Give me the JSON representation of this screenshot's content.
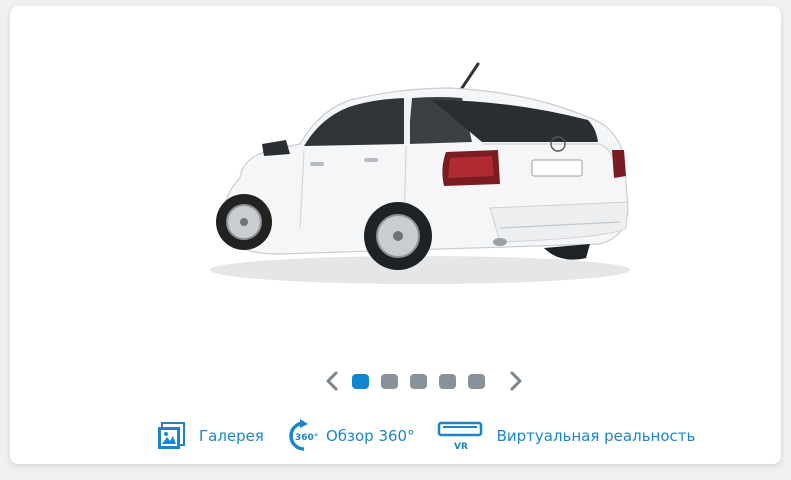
{
  "carousel": {
    "slide_count": 5,
    "active_index": 0,
    "image_alt": "car-photo"
  },
  "actions": {
    "gallery_label": "Галерея",
    "view360_label": "Обзор 360°",
    "view360_icon_text": "360°",
    "vr_label": "Виртуальная реальность",
    "vr_icon_text": "VR"
  },
  "colors": {
    "accent": "#1a86c9",
    "dot_active": "#0e88d2",
    "dot_inactive": "#8a9299"
  }
}
